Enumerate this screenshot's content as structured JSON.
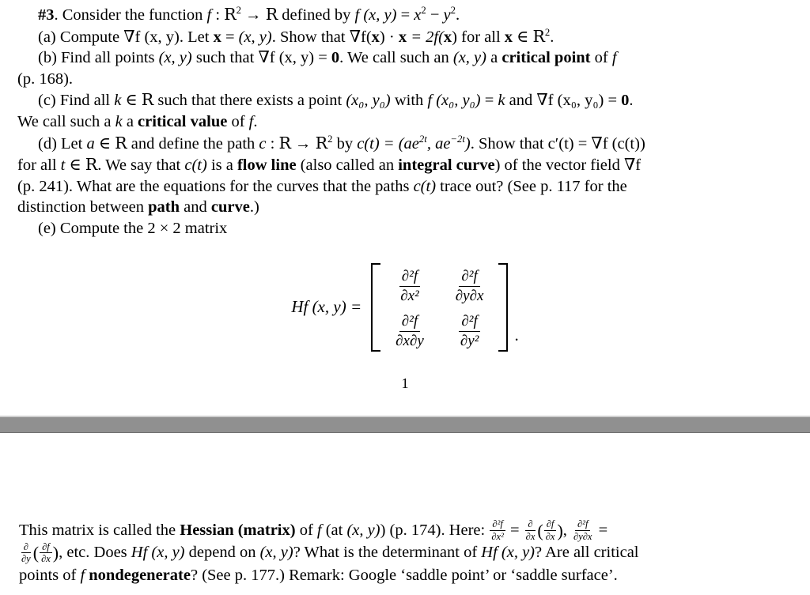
{
  "document": {
    "type": "math-homework-pdf",
    "page_number": "1",
    "background_color": "#ffffff",
    "separator_color": "#909090"
  },
  "page_one": {
    "problem_number": "#3",
    "intro": {
      "lead": ". Consider the function ",
      "f_symbol": "f",
      "colon": " : ",
      "domain": "R",
      "domain_exp": "2",
      "arrow": " → ",
      "codomain": "R",
      "defined_by": " defined by ",
      "function_def_lhs": "f (x, y)",
      "equals": " = ",
      "function_def_rhs_a": "x",
      "function_def_rhs_a_exp": "2",
      "minus": " − ",
      "function_def_rhs_b": "y",
      "function_def_rhs_b_exp": "2",
      "period": "."
    },
    "part_a": {
      "label": "(a)",
      "text_1": " Compute ",
      "grad_f": "∇f (x, y)",
      "text_2": ". Let ",
      "x_bold": "x",
      "text_3": " = ",
      "xy_pair": "(x, y)",
      "text_4": ". Show that ",
      "grad_fx": "∇f(",
      "dot": ") · ",
      "eq_part": " = 2f(",
      "text_5": ") for all ",
      "in_symbol": " ∈ ",
      "r_two": "R",
      "r_two_exp": "2",
      "period": "."
    },
    "part_b": {
      "label": "(b)",
      "text_1": " Find all points ",
      "xy_pair": "(x, y)",
      "text_2": " such that ",
      "grad_f": "∇f (x, y)",
      "text_3": " = ",
      "zero_bold": "0",
      "text_4": ". We call such an ",
      "xy_pair_2": "(x, y)",
      "text_5": " a ",
      "term_bold": "critical point",
      "text_6": " of ",
      "f_symbol": "f",
      "page_ref": "(p. 168).",
      "line_two": "(p. 168)."
    },
    "part_c": {
      "label": "(c)",
      "text_1": " Find all ",
      "k_symbol": "k",
      "in_symbol": " ∈ ",
      "r_symbol": "R",
      "text_2": " such that there exists a point ",
      "point_sub": "(x₀, y₀)",
      "text_3": " with ",
      "f_at_point": "f (x₀, y₀)",
      "text_4": " = ",
      "k_value": "k",
      "text_5": " and ",
      "grad_at_point": "∇f (x₀, y₀)",
      "text_6": " = ",
      "zero_bold": "0",
      "period": ".",
      "line_two_a": "We call such a ",
      "line_two_k": "k",
      "line_two_b": " a ",
      "term_bold": "critical value",
      "line_two_c": " of ",
      "f_symbol": "f",
      "line_two_d": "."
    },
    "part_d": {
      "label": "(d)",
      "text_1": " Let ",
      "a_symbol": "a",
      "in_symbol": " ∈ ",
      "r_symbol": "R",
      "text_2": " and define the path ",
      "c_symbol": "c",
      "colon": " : ",
      "domain": "R",
      "arrow": " → ",
      "codomain": "R",
      "codomain_exp": "2",
      "text_3": " by ",
      "path_def": "c(t) = (ae",
      "exp_1": "2t",
      "path_mid": ", ae",
      "exp_2": "−2t",
      "path_end": ")",
      "text_4": ". Show that ",
      "c_prime": "c′(t) = ∇f (c(t))",
      "line_two_a": "for all ",
      "t_symbol": "t",
      "line_two_in": " ∈ ",
      "line_two_r": "R",
      "line_two_b": ". We say that ",
      "ct": "c(t)",
      "line_two_c": " is a ",
      "term_flow_line": "flow line",
      "line_two_d": " (also called an ",
      "term_integral_curve": "integral curve",
      "line_two_e": ") of the vector field ",
      "grad_f": "∇f",
      "line_three_a": "(p. 241).  What are the equations for the curves that the paths ",
      "line_three_ct": "c(t)",
      "line_three_b": " trace out?  (See p. 117 for the",
      "line_four_a": "distinction between ",
      "term_path": "path",
      "line_four_b": " and ",
      "term_curve": "curve",
      "line_four_c": ".)"
    },
    "part_e": {
      "label": "(e)",
      "text": " Compute the 2 × 2 matrix"
    },
    "hessian_equation": {
      "lhs": "Hf (x, y) =",
      "entries": [
        {
          "num": "∂²f",
          "den": "∂x²"
        },
        {
          "num": "∂²f",
          "den": "∂y∂x"
        },
        {
          "num": "∂²f",
          "den": "∂x∂y"
        },
        {
          "num": "∂²f",
          "den": "∂y²"
        }
      ],
      "trailing_punctuation": "."
    }
  },
  "page_two": {
    "closing": {
      "text_1": "This matrix is called the ",
      "term_hessian": "Hessian (matrix)",
      "text_2": " of ",
      "f_symbol": "f",
      "text_3": " (at ",
      "xy_pair": "(x, y)",
      "text_4": ") (p. 174).  Here: ",
      "frac_1_num": "∂²f",
      "frac_1_den": "∂x²",
      "eq_1": " = ",
      "frac_2_num": "∂",
      "frac_2_den": "∂x",
      "paren_open": "(",
      "frac_3_num": "∂f",
      "frac_3_den": "∂x",
      "paren_close": ")",
      "comma": ", ",
      "frac_4_num": "∂²f",
      "frac_4_den": "∂y∂x",
      "eq_2": " =",
      "line_two_frac_num": "∂",
      "line_two_frac_den": "∂y",
      "line_two_paren_open": "(",
      "line_two_inner_num": "∂f",
      "line_two_inner_den": "∂x",
      "line_two_paren_close": ")",
      "line_two_a": ", etc. Does ",
      "hf": "Hf (x, y)",
      "line_two_b": " depend on ",
      "xy_pair_2": "(x, y)",
      "line_two_c": "? What is the determinant of ",
      "hf_2": "Hf (x, y)",
      "line_two_d": "? Are all critical",
      "line_three_a": "points of ",
      "line_three_f": "f",
      "line_three_b": " ",
      "term_nondegenerate": "nondegenerate",
      "line_three_c": "?  (See p. 177.)  Remark: Google ‘saddle point’ or ‘saddle surface’."
    }
  }
}
